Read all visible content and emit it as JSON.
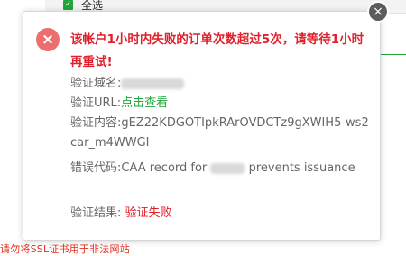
{
  "background": {
    "select_all_label": "全选",
    "checkbox_mark": "✓",
    "footer_warning": "请勿将SSL证书用于非法网站"
  },
  "dialog": {
    "close_glyph": "×",
    "error_glyph": "×",
    "title": "该帐户1小时内失败的订单次数超过5次，请等待1小时再重试!",
    "domain_label": "验证域名:",
    "domain_value_partial": "...",
    "url_label": "验证URL:",
    "url_link": "点击查看",
    "content_label": "验证内容:",
    "content_value": "gEZ22KDGOTIpkRArOVDCTz9gXWIH5-ws2car_m4WWGI",
    "error_code_label": "错误代码:",
    "error_code_prefix": "CAA record for",
    "error_code_suffix": "prevents issuance",
    "result_label": "验证结果:",
    "result_value": "验证失败"
  },
  "colors": {
    "accent_green": "#20a53a",
    "error_red": "#e0202a",
    "error_icon_bg": "#ec6e6e",
    "close_bg": "#5c5c5c"
  }
}
